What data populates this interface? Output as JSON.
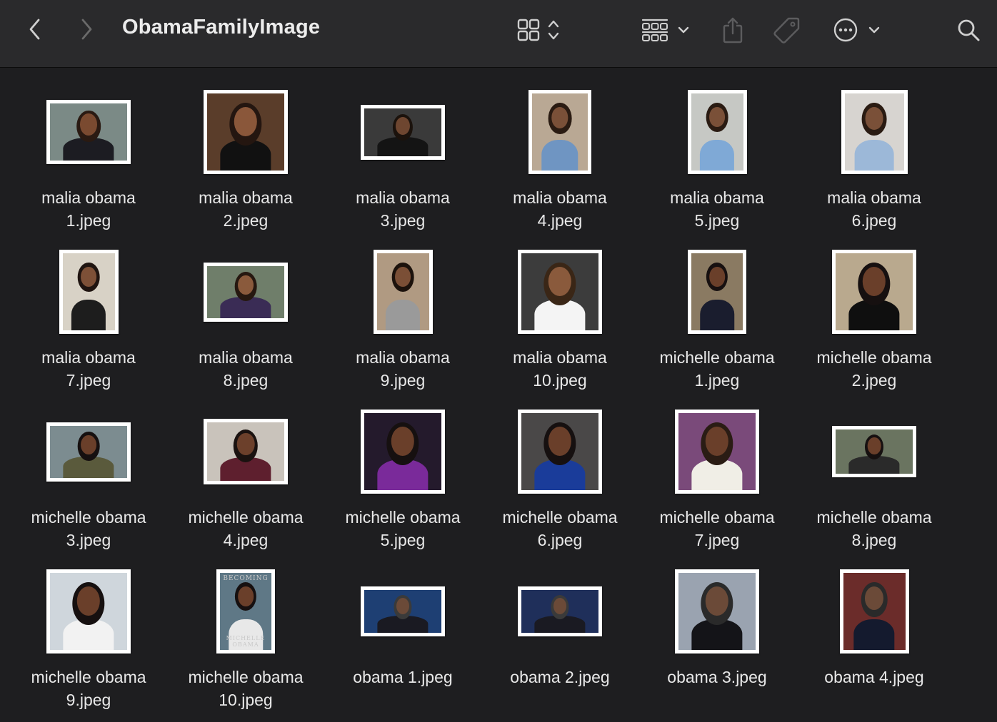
{
  "window": {
    "title": "ObamaFamilyImage"
  },
  "toolbar": {
    "back_icon": "chevron-left-icon",
    "forward_icon": "chevron-right-icon",
    "view_icon": "icon-grid-icon",
    "group_icon": "group-grid-icon",
    "share_icon": "share-icon",
    "tag_icon": "tag-icon",
    "more_icon": "ellipsis-circle-icon",
    "search_icon": "search-icon"
  },
  "files": [
    {
      "line1": "malia obama",
      "line2": "1.jpeg",
      "bg": "#7b8a86",
      "skin": "#7a4a30",
      "shirt": "#1c1c22",
      "hair": "#2a1a12",
      "w": 118,
      "h": 90
    },
    {
      "line1": "malia obama",
      "line2": "2.jpeg",
      "bg": "#5a3d2a",
      "skin": "#8a573a",
      "shirt": "#111111",
      "hair": "#241610",
      "w": 118,
      "h": 118
    },
    {
      "line1": "malia obama",
      "line2": "3.jpeg",
      "bg": "#3a3a3a",
      "skin": "#6e4630",
      "shirt": "#141414",
      "hair": "#1b120c",
      "w": 118,
      "h": 77
    },
    {
      "line1": "malia obama",
      "line2": "4.jpeg",
      "bg": "#b9a894",
      "skin": "#7a5038",
      "shirt": "#6f95c2",
      "hair": "#2a1b12",
      "w": 88,
      "h": 118
    },
    {
      "line1": "malia obama",
      "line2": "5.jpeg",
      "bg": "#c6c8c4",
      "skin": "#7a5038",
      "shirt": "#7fa9d6",
      "hair": "#2a1b12",
      "w": 83,
      "h": 118
    },
    {
      "line1": "malia obama",
      "line2": "6.jpeg",
      "bg": "#d7d4d0",
      "skin": "#7a5038",
      "shirt": "#9cb8d8",
      "hair": "#2a1b12",
      "w": 93,
      "h": 118
    },
    {
      "line1": "malia obama",
      "line2": "7.jpeg",
      "bg": "#d8d2c6",
      "skin": "#7d5037",
      "shirt": "#1d1d1d",
      "hair": "#1f1410",
      "w": 83,
      "h": 118
    },
    {
      "line1": "malia obama",
      "line2": "8.jpeg",
      "bg": "#6f7e6a",
      "skin": "#8a5a3c",
      "shirt": "#3a2c55",
      "hair": "#261810",
      "w": 118,
      "h": 83
    },
    {
      "line1": "malia obama",
      "line2": "9.jpeg",
      "bg": "#b09a82",
      "skin": "#7b4f36",
      "shirt": "#9a9a9a",
      "hair": "#1c120c",
      "w": 83,
      "h": 118
    },
    {
      "line1": "malia obama",
      "line2": "10.jpeg",
      "bg": "#3c3c3c",
      "skin": "#8a5a3c",
      "shirt": "#f4f4f4",
      "hair": "#3a2616",
      "w": 118,
      "h": 118
    },
    {
      "line1": "michelle obama",
      "line2": "1.jpeg",
      "bg": "#8a7a62",
      "skin": "#6a3f2a",
      "shirt": "#1a1d2e",
      "hair": "#171010",
      "w": 82,
      "h": 118
    },
    {
      "line1": "michelle obama",
      "line2": "2.jpeg",
      "bg": "#b9a98e",
      "skin": "#6a3f2a",
      "shirt": "#0f0f0f",
      "hair": "#161010",
      "w": 118,
      "h": 118
    },
    {
      "line1": "michelle obama",
      "line2": "3.jpeg",
      "bg": "#7c8c90",
      "skin": "#6a3f2a",
      "shirt": "#5a5a3c",
      "hair": "#161010",
      "w": 118,
      "h": 83
    },
    {
      "line1": "michelle obama",
      "line2": "4.jpeg",
      "bg": "#c9c3bb",
      "skin": "#6c402b",
      "shirt": "#5e1f2e",
      "hair": "#1a1210",
      "w": 118,
      "h": 92
    },
    {
      "line1": "michelle obama",
      "line2": "5.jpeg",
      "bg": "#241a2c",
      "skin": "#6a3f2a",
      "shirt": "#7a2a9a",
      "hair": "#161010",
      "w": 118,
      "h": 118
    },
    {
      "line1": "michelle obama",
      "line2": "6.jpeg",
      "bg": "#4a4848",
      "skin": "#6a3f2a",
      "shirt": "#1a3c9a",
      "hair": "#161010",
      "w": 118,
      "h": 118
    },
    {
      "line1": "michelle obama",
      "line2": "7.jpeg",
      "bg": "#7a4a7a",
      "skin": "#6a3f2a",
      "shirt": "#f0eee6",
      "hair": "#2a1c14",
      "w": 118,
      "h": 118
    },
    {
      "line1": "michelle obama",
      "line2": "8.jpeg",
      "bg": "#6a7460",
      "skin": "#6a3f2a",
      "shirt": "#2a2a2a",
      "hair": "#161010",
      "w": 118,
      "h": 72
    },
    {
      "line1": "michelle obama",
      "line2": "9.jpeg",
      "bg": "#cfd6dc",
      "skin": "#6a3f2a",
      "shirt": "#f2f2f2",
      "hair": "#161010",
      "w": 118,
      "h": 118
    },
    {
      "line1": "michelle obama",
      "line2": "10.jpeg",
      "bg": "#5f7886",
      "skin": "#6a3f2a",
      "shirt": "#e8e8e8",
      "hair": "#161010",
      "w": 82,
      "h": 118,
      "cover_top": "BECOMING",
      "cover_bottom": "MICHELLE OBAMA"
    },
    {
      "line1": "obama 1.jpeg",
      "line2": "",
      "bg": "#1e3f73",
      "skin": "#6b4a38",
      "shirt": "#1a1a22",
      "hair": "#3a3a3a",
      "w": 118,
      "h": 70
    },
    {
      "line1": "obama 2.jpeg",
      "line2": "",
      "bg": "#1f2f5a",
      "skin": "#6b4a38",
      "shirt": "#1a1a22",
      "hair": "#3a3a3a",
      "w": 118,
      "h": 70
    },
    {
      "line1": "obama 3.jpeg",
      "line2": "",
      "bg": "#9aa3b0",
      "skin": "#6b4a38",
      "shirt": "#141418",
      "hair": "#2a2a2a",
      "w": 118,
      "h": 118
    },
    {
      "line1": "obama 4.jpeg",
      "line2": "",
      "bg": "#6b2c2a",
      "skin": "#6b4a38",
      "shirt": "#141a2e",
      "hair": "#2a2a2a",
      "w": 97,
      "h": 118
    }
  ]
}
